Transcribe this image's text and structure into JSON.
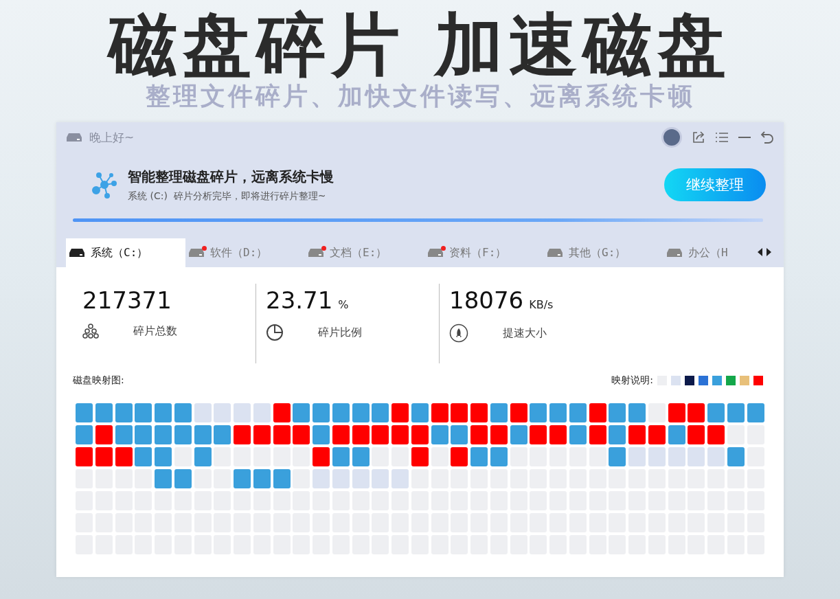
{
  "headline": "磁盘碎片 加速磁盘",
  "subheadline": "整理文件碎片、加快文件读写、远离系统卡顿",
  "window": {
    "greeting": "晚上好~"
  },
  "banner": {
    "title": "智能整理磁盘碎片，远离系统卡慢",
    "subtitle": "系统 (C:)  碎片分析完毕，即将进行碎片整理~",
    "button": "继续整理",
    "level": 1
  },
  "tabs": [
    {
      "label": "系统（C:）",
      "selected": true,
      "alert": false
    },
    {
      "label": "软件（D:）",
      "selected": false,
      "alert": true
    },
    {
      "label": "文档（E:）",
      "selected": false,
      "alert": true
    },
    {
      "label": "资料（F:）",
      "selected": false,
      "alert": true
    },
    {
      "label": "其他（G:）",
      "selected": false,
      "alert": false
    },
    {
      "label": "办公（H",
      "selected": false,
      "alert": false
    }
  ],
  "stats": [
    {
      "kind": "fragments",
      "value": "217371",
      "label": "碎片总数"
    },
    {
      "kind": "ratio",
      "value": "23.71",
      "unit": "%",
      "label": "碎片比例"
    },
    {
      "kind": "speed",
      "value": "18076",
      "unit": "KB/s",
      "label": "提速大小"
    }
  ],
  "map": {
    "title": "磁盘映射图:",
    "legend_title": "映射说明:",
    "legend": [
      {
        "color": "#eeeff2"
      },
      {
        "color": "#dbe2f1"
      },
      {
        "color": "#0c1a4a"
      },
      {
        "color": "#2b72d6"
      },
      {
        "color": "#3aa0dc"
      },
      {
        "color": "#14a74a"
      },
      {
        "color": "#e8c07a"
      },
      {
        "color": "#ff0000"
      }
    ],
    "rows": [
      {
        "cells": [
          {
            "color": "#3aa0dc"
          },
          {
            "color": "#3aa0dc"
          },
          {
            "color": "#3aa0dc"
          },
          {
            "color": "#3aa0dc"
          },
          {
            "color": "#3aa0dc"
          },
          {
            "color": "#3aa0dc"
          },
          {
            "color": "#dbe2f1"
          },
          {
            "color": "#dbe2f1"
          },
          {
            "color": "#dbe2f1"
          },
          {
            "color": "#dbe2f1"
          },
          {
            "color": "#ff0000"
          },
          {
            "color": "#3aa0dc"
          },
          {
            "color": "#3aa0dc"
          },
          {
            "color": "#3aa0dc"
          },
          {
            "color": "#3aa0dc"
          },
          {
            "color": "#3aa0dc"
          },
          {
            "color": "#ff0000"
          },
          {
            "color": "#3aa0dc"
          },
          {
            "color": "#ff0000"
          },
          {
            "color": "#ff0000"
          },
          {
            "color": "#ff0000"
          },
          {
            "color": "#3aa0dc"
          },
          {
            "color": "#ff0000"
          },
          {
            "color": "#3aa0dc"
          },
          {
            "color": "#3aa0dc"
          },
          {
            "color": "#3aa0dc"
          },
          {
            "color": "#ff0000"
          },
          {
            "color": "#3aa0dc"
          },
          {
            "color": "#3aa0dc"
          },
          {
            "color": "#eeeff2"
          },
          {
            "color": "#ff0000"
          },
          {
            "color": "#ff0000"
          },
          {
            "color": "#3aa0dc"
          },
          {
            "color": "#3aa0dc"
          },
          {
            "color": "#3aa0dc"
          }
        ]
      },
      {
        "cells": [
          {
            "color": "#3aa0dc"
          },
          {
            "color": "#ff0000"
          },
          {
            "color": "#3aa0dc"
          },
          {
            "color": "#3aa0dc"
          },
          {
            "color": "#3aa0dc"
          },
          {
            "color": "#3aa0dc"
          },
          {
            "color": "#3aa0dc"
          },
          {
            "color": "#3aa0dc"
          },
          {
            "color": "#ff0000"
          },
          {
            "color": "#ff0000"
          },
          {
            "color": "#ff0000"
          },
          {
            "color": "#ff0000"
          },
          {
            "color": "#3aa0dc"
          },
          {
            "color": "#ff0000"
          },
          {
            "color": "#ff0000"
          },
          {
            "color": "#ff0000"
          },
          {
            "color": "#ff0000"
          },
          {
            "color": "#ff0000"
          },
          {
            "color": "#3aa0dc"
          },
          {
            "color": "#3aa0dc"
          },
          {
            "color": "#ff0000"
          },
          {
            "color": "#ff0000"
          },
          {
            "color": "#3aa0dc"
          },
          {
            "color": "#ff0000"
          },
          {
            "color": "#ff0000"
          },
          {
            "color": "#3aa0dc"
          },
          {
            "color": "#ff0000"
          },
          {
            "color": "#3aa0dc"
          },
          {
            "color": "#ff0000"
          },
          {
            "color": "#ff0000"
          },
          {
            "color": "#3aa0dc"
          },
          {
            "color": "#ff0000"
          },
          {
            "color": "#ff0000"
          },
          {
            "color": "#eeeff2"
          },
          {
            "color": "#eeeff2"
          }
        ]
      },
      {
        "cells": [
          {
            "color": "#ff0000"
          },
          {
            "color": "#ff0000"
          },
          {
            "color": "#ff0000"
          },
          {
            "color": "#3aa0dc"
          },
          {
            "color": "#3aa0dc"
          },
          {
            "color": "#eeeff2"
          },
          {
            "color": "#3aa0dc"
          },
          {
            "color": "#eeeff2"
          },
          {
            "color": "#eeeff2"
          },
          {
            "color": "#eeeff2"
          },
          {
            "color": "#eeeff2"
          },
          {
            "color": "#eeeff2"
          },
          {
            "color": "#ff0000"
          },
          {
            "color": "#3aa0dc"
          },
          {
            "color": "#3aa0dc"
          },
          {
            "color": "#eeeff2"
          },
          {
            "color": "#eeeff2"
          },
          {
            "color": "#ff0000"
          },
          {
            "color": "#eeeff2"
          },
          {
            "color": "#ff0000"
          },
          {
            "color": "#3aa0dc"
          },
          {
            "color": "#3aa0dc"
          },
          {
            "color": "#eeeff2"
          },
          {
            "color": "#eeeff2"
          },
          {
            "color": "#eeeff2"
          },
          {
            "color": "#eeeff2"
          },
          {
            "color": "#eeeff2"
          },
          {
            "color": "#3aa0dc"
          },
          {
            "color": "#dbe2f1"
          },
          {
            "color": "#dbe2f1"
          },
          {
            "color": "#dbe2f1"
          },
          {
            "color": "#dbe2f1"
          },
          {
            "color": "#dbe2f1"
          },
          {
            "color": "#3aa0dc"
          },
          {
            "color": "#eeeff2"
          }
        ]
      },
      {
        "cells": [
          {
            "color": "#eeeff2"
          },
          {
            "color": "#eeeff2"
          },
          {
            "color": "#eeeff2"
          },
          {
            "color": "#eeeff2"
          },
          {
            "color": "#3aa0dc"
          },
          {
            "color": "#3aa0dc"
          },
          {
            "color": "#eeeff2"
          },
          {
            "color": "#eeeff2"
          },
          {
            "color": "#3aa0dc"
          },
          {
            "color": "#3aa0dc"
          },
          {
            "color": "#3aa0dc"
          },
          {
            "color": "#eeeff2"
          },
          {
            "color": "#dbe2f1"
          },
          {
            "color": "#dbe2f1"
          },
          {
            "color": "#dbe2f1"
          },
          {
            "color": "#dbe2f1"
          },
          {
            "color": "#dbe2f1"
          },
          {
            "color": "#eeeff2"
          },
          {
            "color": "#eeeff2"
          },
          {
            "color": "#eeeff2"
          },
          {
            "color": "#eeeff2"
          },
          {
            "color": "#eeeff2"
          },
          {
            "color": "#eeeff2"
          },
          {
            "color": "#eeeff2"
          },
          {
            "color": "#eeeff2"
          },
          {
            "color": "#eeeff2"
          },
          {
            "color": "#eeeff2"
          },
          {
            "color": "#eeeff2"
          },
          {
            "color": "#eeeff2"
          },
          {
            "color": "#eeeff2"
          },
          {
            "color": "#eeeff2"
          },
          {
            "color": "#eeeff2"
          },
          {
            "color": "#eeeff2"
          },
          {
            "color": "#eeeff2"
          },
          {
            "color": "#eeeff2"
          }
        ]
      },
      {
        "cells": [
          {
            "color": "#eeeff2"
          },
          {
            "color": "#eeeff2"
          },
          {
            "color": "#eeeff2"
          },
          {
            "color": "#eeeff2"
          },
          {
            "color": "#eeeff2"
          },
          {
            "color": "#eeeff2"
          },
          {
            "color": "#eeeff2"
          },
          {
            "color": "#eeeff2"
          },
          {
            "color": "#eeeff2"
          },
          {
            "color": "#eeeff2"
          },
          {
            "color": "#eeeff2"
          },
          {
            "color": "#eeeff2"
          },
          {
            "color": "#eeeff2"
          },
          {
            "color": "#eeeff2"
          },
          {
            "color": "#eeeff2"
          },
          {
            "color": "#eeeff2"
          },
          {
            "color": "#eeeff2"
          },
          {
            "color": "#eeeff2"
          },
          {
            "color": "#eeeff2"
          },
          {
            "color": "#eeeff2"
          },
          {
            "color": "#eeeff2"
          },
          {
            "color": "#eeeff2"
          },
          {
            "color": "#eeeff2"
          },
          {
            "color": "#eeeff2"
          },
          {
            "color": "#eeeff2"
          },
          {
            "color": "#eeeff2"
          },
          {
            "color": "#eeeff2"
          },
          {
            "color": "#eeeff2"
          },
          {
            "color": "#eeeff2"
          },
          {
            "color": "#eeeff2"
          },
          {
            "color": "#eeeff2"
          },
          {
            "color": "#eeeff2"
          },
          {
            "color": "#eeeff2"
          },
          {
            "color": "#eeeff2"
          },
          {
            "color": "#eeeff2"
          }
        ]
      },
      {
        "cells": [
          {
            "color": "#eeeff2"
          },
          {
            "color": "#eeeff2"
          },
          {
            "color": "#eeeff2"
          },
          {
            "color": "#eeeff2"
          },
          {
            "color": "#eeeff2"
          },
          {
            "color": "#eeeff2"
          },
          {
            "color": "#eeeff2"
          },
          {
            "color": "#eeeff2"
          },
          {
            "color": "#eeeff2"
          },
          {
            "color": "#eeeff2"
          },
          {
            "color": "#eeeff2"
          },
          {
            "color": "#eeeff2"
          },
          {
            "color": "#eeeff2"
          },
          {
            "color": "#eeeff2"
          },
          {
            "color": "#eeeff2"
          },
          {
            "color": "#eeeff2"
          },
          {
            "color": "#eeeff2"
          },
          {
            "color": "#eeeff2"
          },
          {
            "color": "#eeeff2"
          },
          {
            "color": "#eeeff2"
          },
          {
            "color": "#eeeff2"
          },
          {
            "color": "#eeeff2"
          },
          {
            "color": "#eeeff2"
          },
          {
            "color": "#eeeff2"
          },
          {
            "color": "#eeeff2"
          },
          {
            "color": "#eeeff2"
          },
          {
            "color": "#eeeff2"
          },
          {
            "color": "#eeeff2"
          },
          {
            "color": "#eeeff2"
          },
          {
            "color": "#eeeff2"
          },
          {
            "color": "#eeeff2"
          },
          {
            "color": "#eeeff2"
          },
          {
            "color": "#eeeff2"
          },
          {
            "color": "#eeeff2"
          },
          {
            "color": "#eeeff2"
          }
        ]
      },
      {
        "cells": [
          {
            "color": "#eeeff2"
          },
          {
            "color": "#eeeff2"
          },
          {
            "color": "#eeeff2"
          },
          {
            "color": "#eeeff2"
          },
          {
            "color": "#eeeff2"
          },
          {
            "color": "#eeeff2"
          },
          {
            "color": "#eeeff2"
          },
          {
            "color": "#eeeff2"
          },
          {
            "color": "#eeeff2"
          },
          {
            "color": "#eeeff2"
          },
          {
            "color": "#eeeff2"
          },
          {
            "color": "#eeeff2"
          },
          {
            "color": "#eeeff2"
          },
          {
            "color": "#eeeff2"
          },
          {
            "color": "#eeeff2"
          },
          {
            "color": "#eeeff2"
          },
          {
            "color": "#eeeff2"
          },
          {
            "color": "#eeeff2"
          },
          {
            "color": "#eeeff2"
          },
          {
            "color": "#eeeff2"
          },
          {
            "color": "#eeeff2"
          },
          {
            "color": "#eeeff2"
          },
          {
            "color": "#eeeff2"
          },
          {
            "color": "#eeeff2"
          },
          {
            "color": "#eeeff2"
          },
          {
            "color": "#eeeff2"
          },
          {
            "color": "#eeeff2"
          },
          {
            "color": "#eeeff2"
          },
          {
            "color": "#eeeff2"
          },
          {
            "color": "#eeeff2"
          },
          {
            "color": "#eeeff2"
          },
          {
            "color": "#eeeff2"
          },
          {
            "color": "#eeeff2"
          },
          {
            "color": "#eeeff2"
          },
          {
            "color": "#eeeff2"
          }
        ]
      }
    ]
  }
}
